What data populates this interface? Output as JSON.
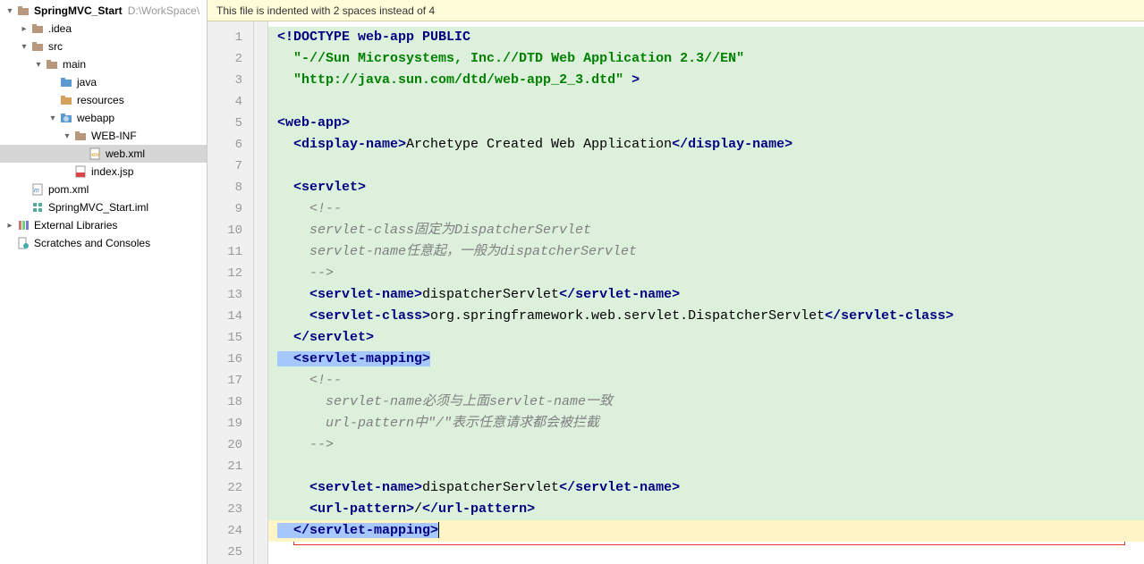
{
  "sidebar": {
    "project_name": "SpringMVC_Start",
    "project_path": "D:\\WorkSpace\\",
    "nodes": {
      "idea": ".idea",
      "src": "src",
      "main": "main",
      "java": "java",
      "resources": "resources",
      "webapp": "webapp",
      "webinf": "WEB-INF",
      "webxml": "web.xml",
      "indexjsp": "index.jsp",
      "pom": "pom.xml",
      "iml": "SpringMVC_Start.iml",
      "extlib": "External Libraries",
      "scratches": "Scratches and Consoles"
    }
  },
  "warn": "This file is indented with 2 spaces instead of 4",
  "gutter": [
    "1",
    "2",
    "3",
    "4",
    "5",
    "6",
    "7",
    "8",
    "9",
    "10",
    "11",
    "12",
    "13",
    "14",
    "15",
    "16",
    "17",
    "18",
    "19",
    "20",
    "21",
    "22",
    "23",
    "24",
    "25"
  ],
  "code": {
    "l1a": "<!DOCTYPE ",
    "l1b": "web-app",
    "l1c": " PUBLIC",
    "l2": "\"-//Sun Microsystems, Inc.//DTD Web Application 2.3//EN\"",
    "l3a": "\"http://java.sun.com/dtd/web-app_2_3.dtd\"",
    "l3b": " >",
    "l5o": "<web-app>",
    "l6a": "  <display-name>",
    "l6t": "Archetype Created Web Application",
    "l6c": "</display-name>",
    "l8o": "  <servlet>",
    "l9": "    <!--",
    "l10": "    servlet-class固定为DispatcherServlet",
    "l11": "    servlet-name任意起，一般为dispatcherServlet",
    "l12": "    -->",
    "l13a": "    <servlet-name>",
    "l13t": "dispatcherServlet",
    "l13c": "</servlet-name>",
    "l14a": "    <servlet-class>",
    "l14t": "org.springframework.web.servlet.DispatcherServlet",
    "l14c": "</servlet-class>",
    "l15": "  </servlet>",
    "l16": "  <servlet-mapping>",
    "l17": "    <!--",
    "l18": "      servlet-name必须与上面servlet-name一致",
    "l19": "      url-pattern中\"/\"表示任意请求都会被拦截",
    "l20": "    -->",
    "l22a": "    <servlet-name>",
    "l22t": "dispatcherServlet",
    "l22c": "</servlet-name>",
    "l23a": "    <url-pattern>",
    "l23t": "/",
    "l23c": "</url-pattern>",
    "l24": "  </servlet-mapping>"
  }
}
